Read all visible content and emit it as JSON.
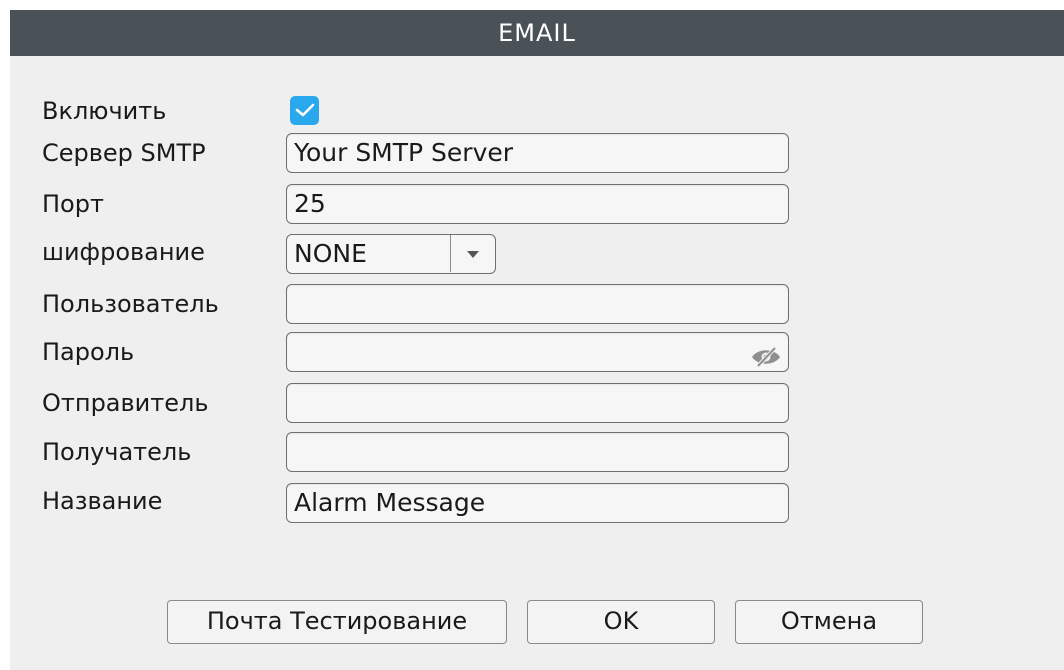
{
  "dialog": {
    "title": "EMAIL"
  },
  "form": {
    "enable_label": "Включить",
    "enable_checked": true,
    "smtp_label": "Сервер SMTP",
    "smtp_value": "Your SMTP Server",
    "port_label": "Порт",
    "port_value": "25",
    "encryption_label": "шифрование",
    "encryption_value": "NONE",
    "user_label": "Пользователь",
    "user_value": "",
    "password_label": "Пароль",
    "password_value": "",
    "sender_label": "Отправитель",
    "sender_value": "",
    "recipient_label": "Получатель",
    "recipient_value": "",
    "subject_label": "Название",
    "subject_value": "Alarm Message"
  },
  "buttons": {
    "test_label": "Почта Тестирование",
    "ok_label": "OK",
    "cancel_label": "Отмена"
  },
  "icons": {
    "checkbox": "checkmark-icon",
    "select_arrow": "triangle-down-icon",
    "password_toggle": "eye-slash-icon"
  },
  "colors": {
    "titlebar": "#4b5257",
    "checkbox": "#2aa8ee",
    "dialog_bg": "#efefef"
  }
}
